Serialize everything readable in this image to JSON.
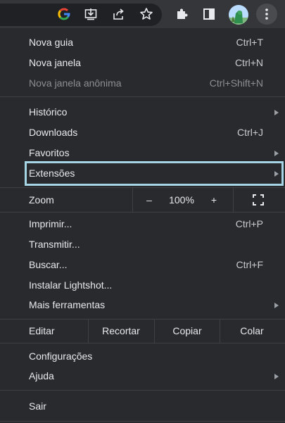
{
  "toolbar": {
    "icons": [
      "google-icon",
      "install-app-icon",
      "share-icon",
      "bookmark-star-icon",
      "extensions-icon",
      "side-panel-icon",
      "avatar",
      "more-menu-icon"
    ]
  },
  "menu": {
    "group1": [
      {
        "label": "Nova guia",
        "shortcut": "Ctrl+T"
      },
      {
        "label": "Nova janela",
        "shortcut": "Ctrl+N"
      },
      {
        "label": "Nova janela anônima",
        "shortcut": "Ctrl+Shift+N"
      }
    ],
    "group2": [
      {
        "label": "Histórico"
      },
      {
        "label": "Downloads",
        "shortcut": "Ctrl+J"
      },
      {
        "label": "Favoritos"
      },
      {
        "label": "Extensões"
      }
    ],
    "zoom": {
      "label": "Zoom",
      "minus": "–",
      "value": "100%",
      "plus": "+"
    },
    "group3": [
      {
        "label": "Imprimir...",
        "shortcut": "Ctrl+P"
      },
      {
        "label": "Transmitir..."
      },
      {
        "label": "Buscar...",
        "shortcut": "Ctrl+F"
      },
      {
        "label": "Instalar Lightshot..."
      },
      {
        "label": "Mais ferramentas"
      }
    ],
    "edit": {
      "label": "Editar",
      "cut": "Recortar",
      "copy": "Copiar",
      "paste": "Colar"
    },
    "group4": [
      {
        "label": "Configurações"
      },
      {
        "label": "Ajuda"
      }
    ],
    "exit": {
      "label": "Sair"
    }
  },
  "colors": {
    "menu_bg": "#292a2d",
    "toolbar_bg": "#35363a",
    "highlight_outline": "#a6d6e6",
    "disabled_text": "#8b8e93"
  }
}
